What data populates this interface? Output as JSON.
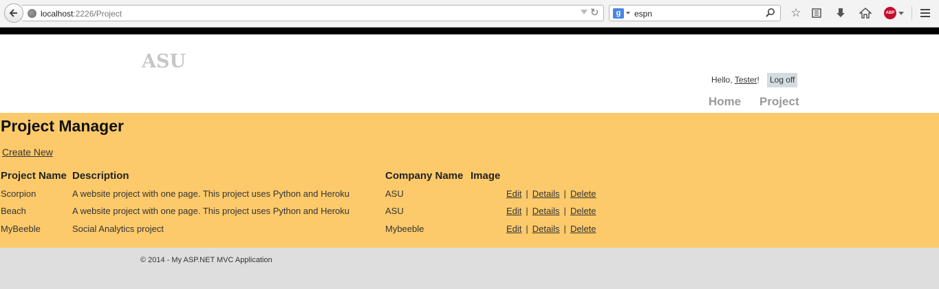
{
  "browser": {
    "url_host": "localhost",
    "url_rest": ":2226/Project",
    "search_query": "espn",
    "engine_label": "g",
    "abp_label": "ABP"
  },
  "site": {
    "title": "ASU",
    "greeting_prefix": "Hello,",
    "user": "Tester",
    "greeting_suffix": "!",
    "logoff": "Log off",
    "nav": [
      "Home",
      "Project"
    ]
  },
  "main": {
    "heading": "Project Manager",
    "create_new": "Create New",
    "columns": [
      "Project Name",
      "Description",
      "Company Name",
      "Image"
    ],
    "rows": [
      {
        "name": "Scorpion",
        "description": "A website project with one page. This project uses Python and Heroku",
        "company": "ASU"
      },
      {
        "name": "Beach",
        "description": "A website project with one page. This project uses Python and Heroku",
        "company": "ASU"
      },
      {
        "name": "MyBeeble",
        "description": "Social Analytics project",
        "company": "Mybeeble"
      }
    ],
    "actions": {
      "edit": "Edit",
      "separator": "|",
      "details": "Details",
      "delete": "Delete"
    }
  },
  "footer": {
    "copyright": "© 2014 - My ASP.NET MVC Application"
  },
  "colors": {
    "main_bg": "#fdca6b",
    "footer_bg": "#dedede",
    "top_strip": "#000000"
  }
}
